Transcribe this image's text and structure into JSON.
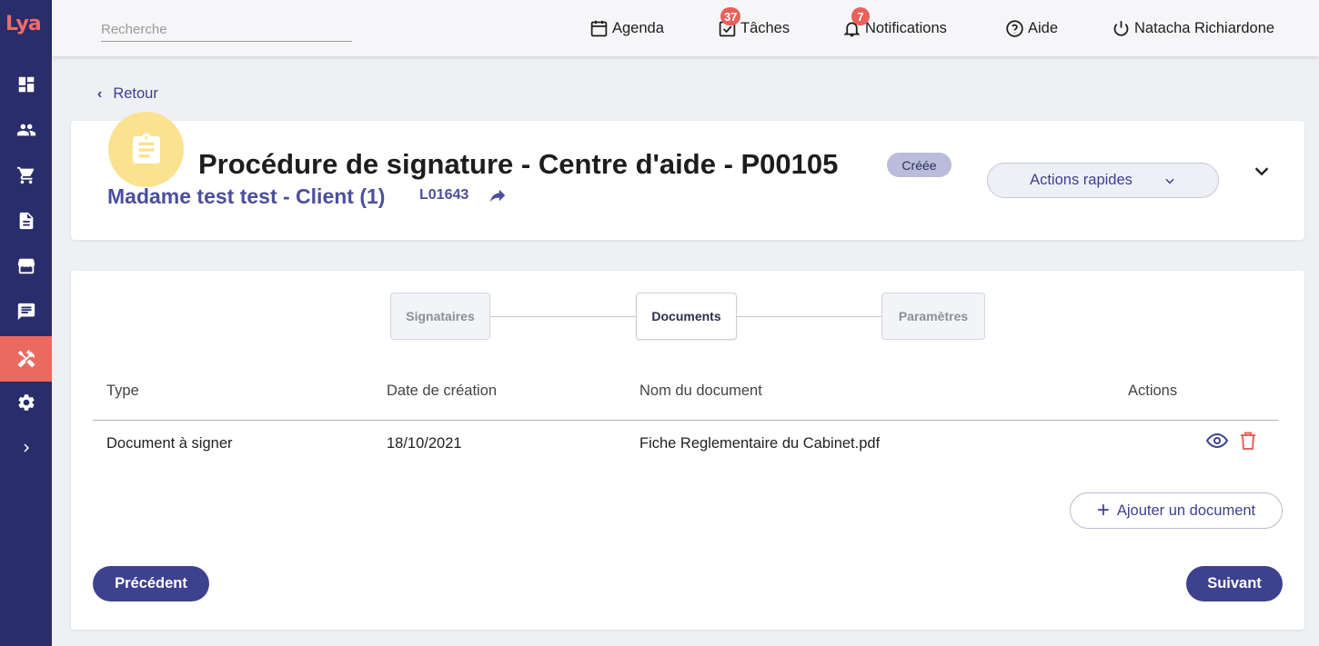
{
  "app": {
    "logo_text": "Lya"
  },
  "sidebar": {
    "items": [
      {
        "name": "dashboard",
        "icon": "dashboard-icon"
      },
      {
        "name": "contacts",
        "icon": "people-icon"
      },
      {
        "name": "shop",
        "icon": "cart-icon"
      },
      {
        "name": "documents",
        "icon": "document-icon"
      },
      {
        "name": "store",
        "icon": "store-icon"
      },
      {
        "name": "messages",
        "icon": "message-icon"
      },
      {
        "name": "tools",
        "icon": "tools-icon",
        "active": true
      },
      {
        "name": "settings",
        "icon": "gear-icon"
      },
      {
        "name": "expand",
        "icon": "chevron-right-icon"
      }
    ],
    "colors": {
      "background": "#2a2d6b",
      "active": "#ea6a60"
    }
  },
  "topbar": {
    "search_placeholder": "Recherche",
    "agenda_label": "Agenda",
    "tasks_label": "Tâches",
    "tasks_count": "37",
    "notifications_label": "Notifications",
    "notifications_count": "7",
    "help_label": "Aide",
    "user_name": "Natacha Richiardone"
  },
  "nav": {
    "back_label": "Retour"
  },
  "header": {
    "title": "Procédure de signature - Centre d'aide - P00105",
    "status": "Créée",
    "client_name": "Madame test test - Client (1)",
    "client_ref": "L01643",
    "quick_actions_label": "Actions rapides"
  },
  "stepper": {
    "steps": [
      {
        "label": "Signataires",
        "state": "inactive"
      },
      {
        "label": "Documents",
        "state": "current"
      },
      {
        "label": "Paramètres",
        "state": "inactive"
      }
    ]
  },
  "table": {
    "columns": [
      "Type",
      "Date de création",
      "Nom du document",
      "Actions"
    ],
    "rows": [
      {
        "type": "Document à signer",
        "date": "18/10/2021",
        "name": "Fiche Reglementaire du Cabinet.pdf",
        "actions": [
          "eye-icon",
          "trash-icon"
        ]
      }
    ]
  },
  "buttons": {
    "add_document": "Ajouter un document",
    "previous": "Précédent",
    "next": "Suivant"
  },
  "colors": {
    "accent": "#3d418e",
    "danger": "#e9615a",
    "avatar": "#fbe28f"
  }
}
